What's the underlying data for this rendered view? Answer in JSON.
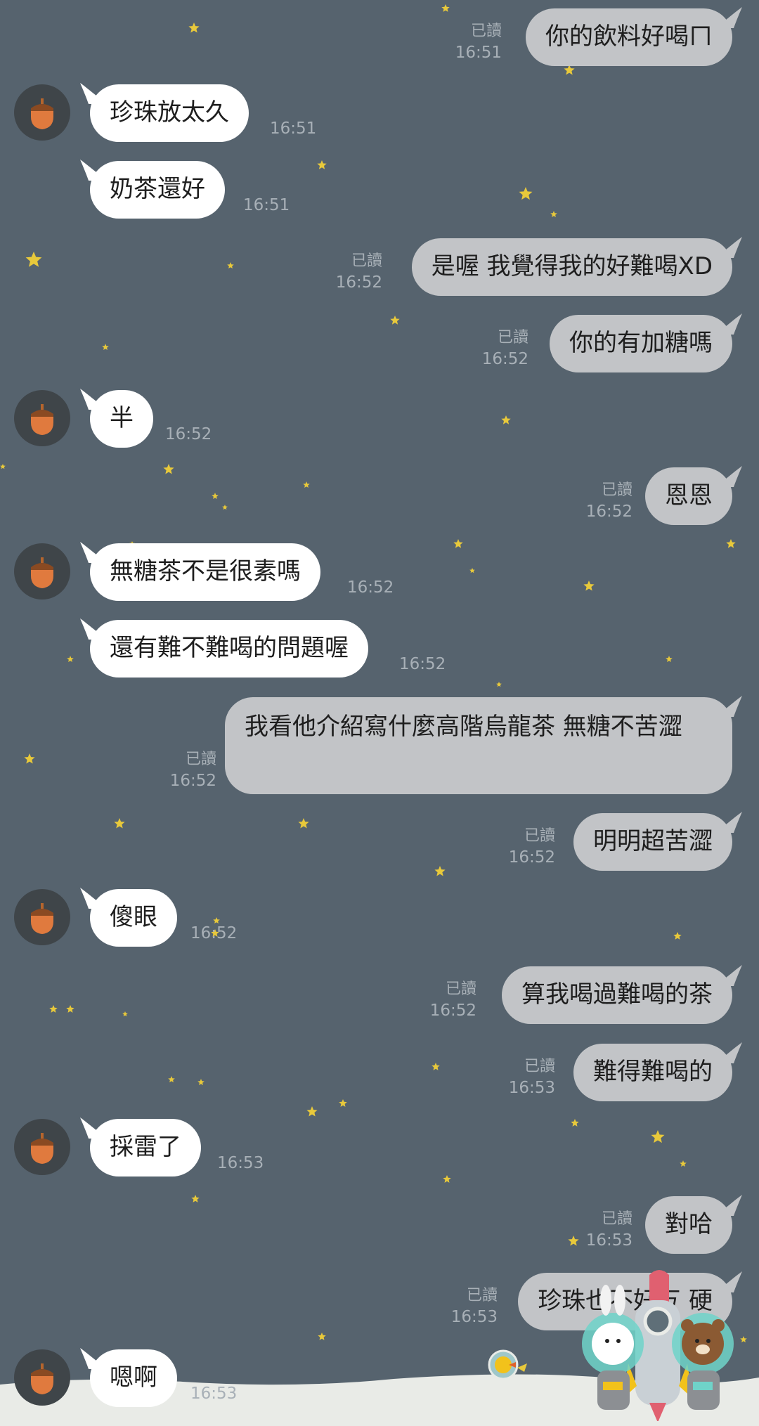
{
  "colors": {
    "background": "#56636e",
    "received_bubble": "#ffffff",
    "sent_bubble": "#c2c4c7",
    "star": "#e8c93b",
    "meta_text": "#a8b0b7"
  },
  "contact_avatar": "acorn-icon",
  "messages": [
    {
      "side": "sent",
      "text": "你的飲料好喝ㄇ",
      "read": "已讀",
      "time": "16:51"
    },
    {
      "side": "received",
      "text": "珍珠放太久",
      "time": "16:51",
      "avatar": true
    },
    {
      "side": "received",
      "text": "奶茶還好",
      "time": "16:51",
      "avatar": false
    },
    {
      "side": "sent",
      "text": "是喔 我覺得我的好難喝XD",
      "read": "已讀",
      "time": "16:52"
    },
    {
      "side": "sent",
      "text": "你的有加糖嗎",
      "read": "已讀",
      "time": "16:52"
    },
    {
      "side": "received",
      "text": "半",
      "time": "16:52",
      "avatar": true
    },
    {
      "side": "sent",
      "text": "恩恩",
      "read": "已讀",
      "time": "16:52"
    },
    {
      "side": "received",
      "text": "無糖茶不是很素嗎",
      "time": "16:52",
      "avatar": true
    },
    {
      "side": "received",
      "text": "還有難不難喝的問題喔",
      "time": "16:52",
      "avatar": false
    },
    {
      "side": "sent",
      "text": "我看他介紹寫什麼高階烏龍茶 無糖不苦澀",
      "read": "已讀",
      "time": "16:52"
    },
    {
      "side": "sent",
      "text": "明明超苦澀",
      "read": "已讀",
      "time": "16:52"
    },
    {
      "side": "received",
      "text": "傻眼",
      "time": "16:52",
      "avatar": true
    },
    {
      "side": "sent",
      "text": "算我喝過難喝的茶",
      "read": "已讀",
      "time": "16:52"
    },
    {
      "side": "sent",
      "text": "難得難喝的",
      "read": "已讀",
      "time": "16:53"
    },
    {
      "side": "received",
      "text": "採雷了",
      "time": "16:53",
      "avatar": true
    },
    {
      "side": "sent",
      "text": "對哈",
      "read": "已讀",
      "time": "16:53"
    },
    {
      "side": "sent",
      "text": "珍珠也不好ㄎ 硬",
      "read": "已讀",
      "time": "16:53"
    },
    {
      "side": "received",
      "text": "嗯啊",
      "time": "16:53",
      "avatar": true
    }
  ]
}
